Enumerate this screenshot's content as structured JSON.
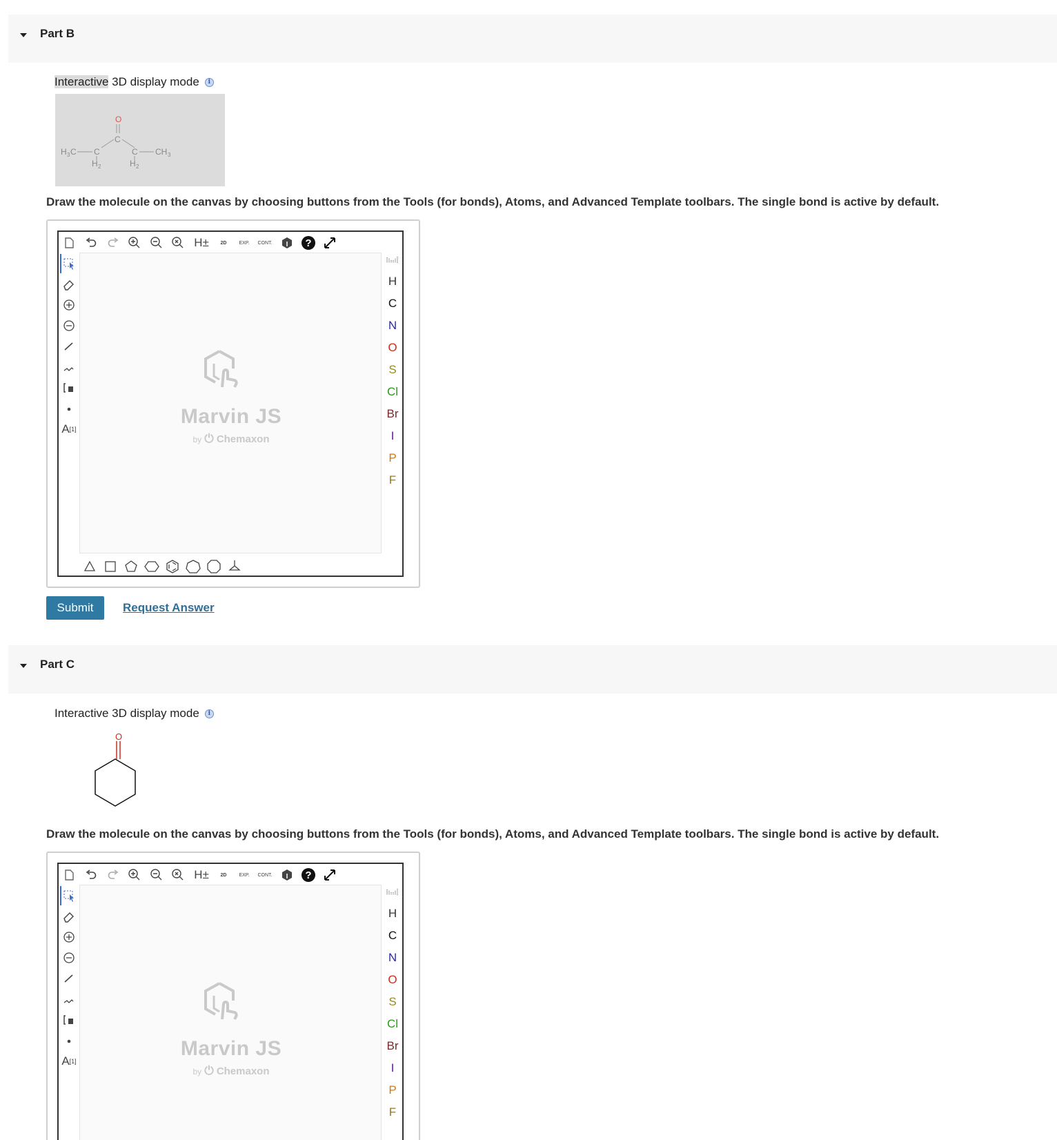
{
  "parts": {
    "b": {
      "header": "Part B",
      "mode_highlight": "Interactive",
      "mode_rest": " 3D display mode",
      "instruction": "Draw the molecule on the canvas by choosing buttons from the Tools (for bonds), Atoms, and Advanced Template toolbars. The single bond is active by default.",
      "submit": "Submit",
      "request_answer": "Request Answer"
    },
    "c": {
      "header": "Part C",
      "mode_highlight": "Interactive",
      "mode_rest": " 3D display mode",
      "instruction": "Draw the molecule on the canvas by choosing buttons from the Tools (for bonds), Atoms, and Advanced Template toolbars. The single bond is active by default."
    }
  },
  "editor": {
    "watermark_title": "Marvin JS",
    "watermark_by": "by",
    "watermark_brand": "Chemaxon",
    "top_toolbar": {
      "hydrogen_label": "H±",
      "clean_label": "2D",
      "expand_label": "EXP.",
      "contract_label": "CONT."
    },
    "left_toolbar": {
      "atom_label": "A",
      "atom_index": "[1]"
    },
    "atoms": [
      {
        "symbol": "H",
        "color": "#333333"
      },
      {
        "symbol": "C",
        "color": "#111111"
      },
      {
        "symbol": "N",
        "color": "#2b2b9b"
      },
      {
        "symbol": "O",
        "color": "#d42a1c"
      },
      {
        "symbol": "S",
        "color": "#9a8a1a"
      },
      {
        "symbol": "Cl",
        "color": "#2a9a1a"
      },
      {
        "symbol": "Br",
        "color": "#7a2a2a"
      },
      {
        "symbol": "I",
        "color": "#6a1a9a"
      },
      {
        "symbol": "P",
        "color": "#d07a10"
      },
      {
        "symbol": "F",
        "color": "#9a7a1a"
      }
    ]
  },
  "molecule_b": {
    "labels": {
      "h3c": "H",
      "h3c_sub": "3",
      "h3c_c": "C",
      "ch3": "CH",
      "ch3_sub": "3",
      "o": "O",
      "c_mid": "C",
      "c_left": "C",
      "c_right": "C",
      "h2": "H",
      "h2_sub": "2"
    }
  },
  "molecule_c": {
    "labels": {
      "o": "O"
    }
  }
}
